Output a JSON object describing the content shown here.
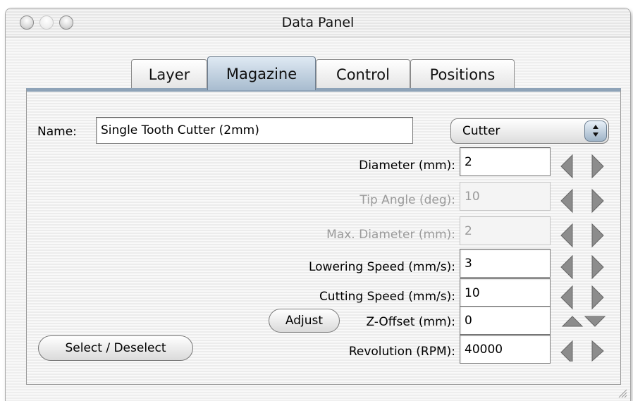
{
  "window": {
    "title": "Data Panel"
  },
  "tabs": [
    {
      "label": "Layer",
      "active": false
    },
    {
      "label": "Magazine",
      "active": true
    },
    {
      "label": "Control",
      "active": false
    },
    {
      "label": "Positions",
      "active": false
    }
  ],
  "name_field": {
    "label": "Name:",
    "value": "Single Tooth Cutter (2mm)"
  },
  "type_popup": {
    "selected": "Cutter"
  },
  "params": {
    "diameter": {
      "label": "Diameter (mm):",
      "value": "2",
      "enabled": true
    },
    "tip_angle": {
      "label": "Tip Angle (deg):",
      "value": "10",
      "enabled": false
    },
    "max_diameter": {
      "label": "Max. Diameter (mm):",
      "value": "2",
      "enabled": false
    },
    "lowering_speed": {
      "label": "Lowering Speed (mm/s):",
      "value": "3",
      "enabled": true
    },
    "cutting_speed": {
      "label": "Cutting Speed (mm/s):",
      "value": "10",
      "enabled": true
    },
    "z_offset": {
      "label": "Z-Offset (mm):",
      "value": "0",
      "enabled": true
    },
    "revolution": {
      "label": "Revolution (RPM):",
      "value": "40000",
      "enabled": true
    }
  },
  "buttons": {
    "adjust": "Adjust",
    "select_deselect": "Select / Deselect"
  },
  "colors": {
    "tab_active": "#a8bccf",
    "arrow_enabled": "#8c8c8c",
    "arrow_disabled": "#bdbdbd"
  }
}
